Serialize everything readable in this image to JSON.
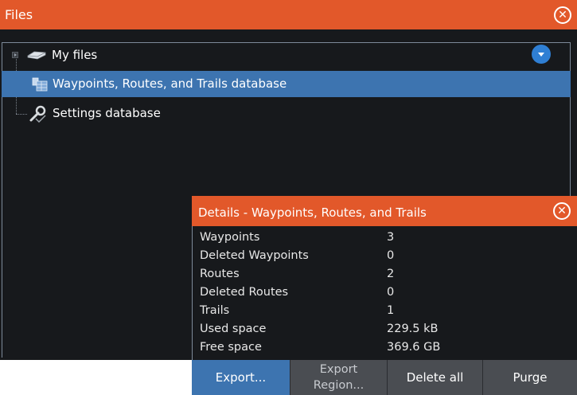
{
  "window": {
    "title": "Files",
    "close_icon": "close-circle-icon"
  },
  "tree": {
    "root": {
      "label": "My files",
      "icon": "drive-icon"
    },
    "items": [
      {
        "label": "Waypoints, Routes, and Trails database",
        "icon": "database-icon",
        "selected": true
      },
      {
        "label": "Settings database",
        "icon": "settings-database-icon",
        "selected": false
      }
    ],
    "dropdown_icon": "chevron-down-icon"
  },
  "details": {
    "title": "Details - Waypoints, Routes, and Trails",
    "rows": [
      {
        "key": "Waypoints",
        "value": "3"
      },
      {
        "key": "Deleted Waypoints",
        "value": "0"
      },
      {
        "key": "Routes",
        "value": "2"
      },
      {
        "key": "Deleted Routes",
        "value": "0"
      },
      {
        "key": "Trails",
        "value": "1"
      },
      {
        "key": "Used space",
        "value": "229.5 kB"
      },
      {
        "key": "Free space",
        "value": "369.6 GB"
      }
    ],
    "buttons": {
      "export": "Export...",
      "export_region_line1": "Export",
      "export_region_line2": "Region...",
      "delete_all": "Delete all",
      "purge": "Purge"
    }
  },
  "colors": {
    "header": "#e2582a",
    "selection": "#3d74b0",
    "background": "#17191c",
    "button_bar": "#4a4d52"
  }
}
